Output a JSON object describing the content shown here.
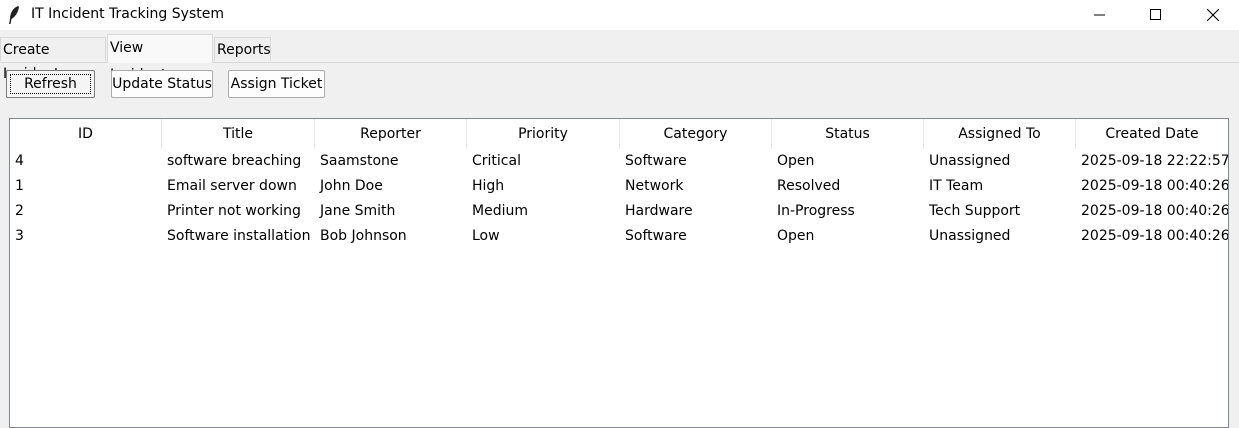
{
  "window": {
    "title": "IT Incident Tracking System",
    "icon": "feather-icon"
  },
  "tabs": [
    {
      "label": "Create Incident",
      "active": false
    },
    {
      "label": "View Incidents",
      "active": true
    },
    {
      "label": "Reports",
      "active": false
    }
  ],
  "toolbar": {
    "refresh_label": "Refresh",
    "update_status_label": "Update Status",
    "assign_ticket_label": "Assign Ticket"
  },
  "table": {
    "columns": [
      "ID",
      "Title",
      "Reporter",
      "Priority",
      "Category",
      "Status",
      "Assigned To",
      "Created Date"
    ],
    "rows": [
      [
        "4",
        "software breaching",
        "Saamstone",
        "Critical",
        "Software",
        "Open",
        "Unassigned",
        "2025-09-18 22:22:57"
      ],
      [
        "1",
        "Email server down",
        "John Doe",
        "High",
        "Network",
        "Resolved",
        "IT Team",
        "2025-09-18 00:40:26"
      ],
      [
        "2",
        "Printer not working",
        "Jane Smith",
        "Medium",
        "Hardware",
        "In-Progress",
        "Tech Support",
        "2025-09-18 00:40:26"
      ],
      [
        "3",
        "Software installation r",
        "Bob Johnson",
        "Low",
        "Software",
        "Open",
        "Unassigned",
        "2025-09-18 00:40:26"
      ]
    ]
  }
}
